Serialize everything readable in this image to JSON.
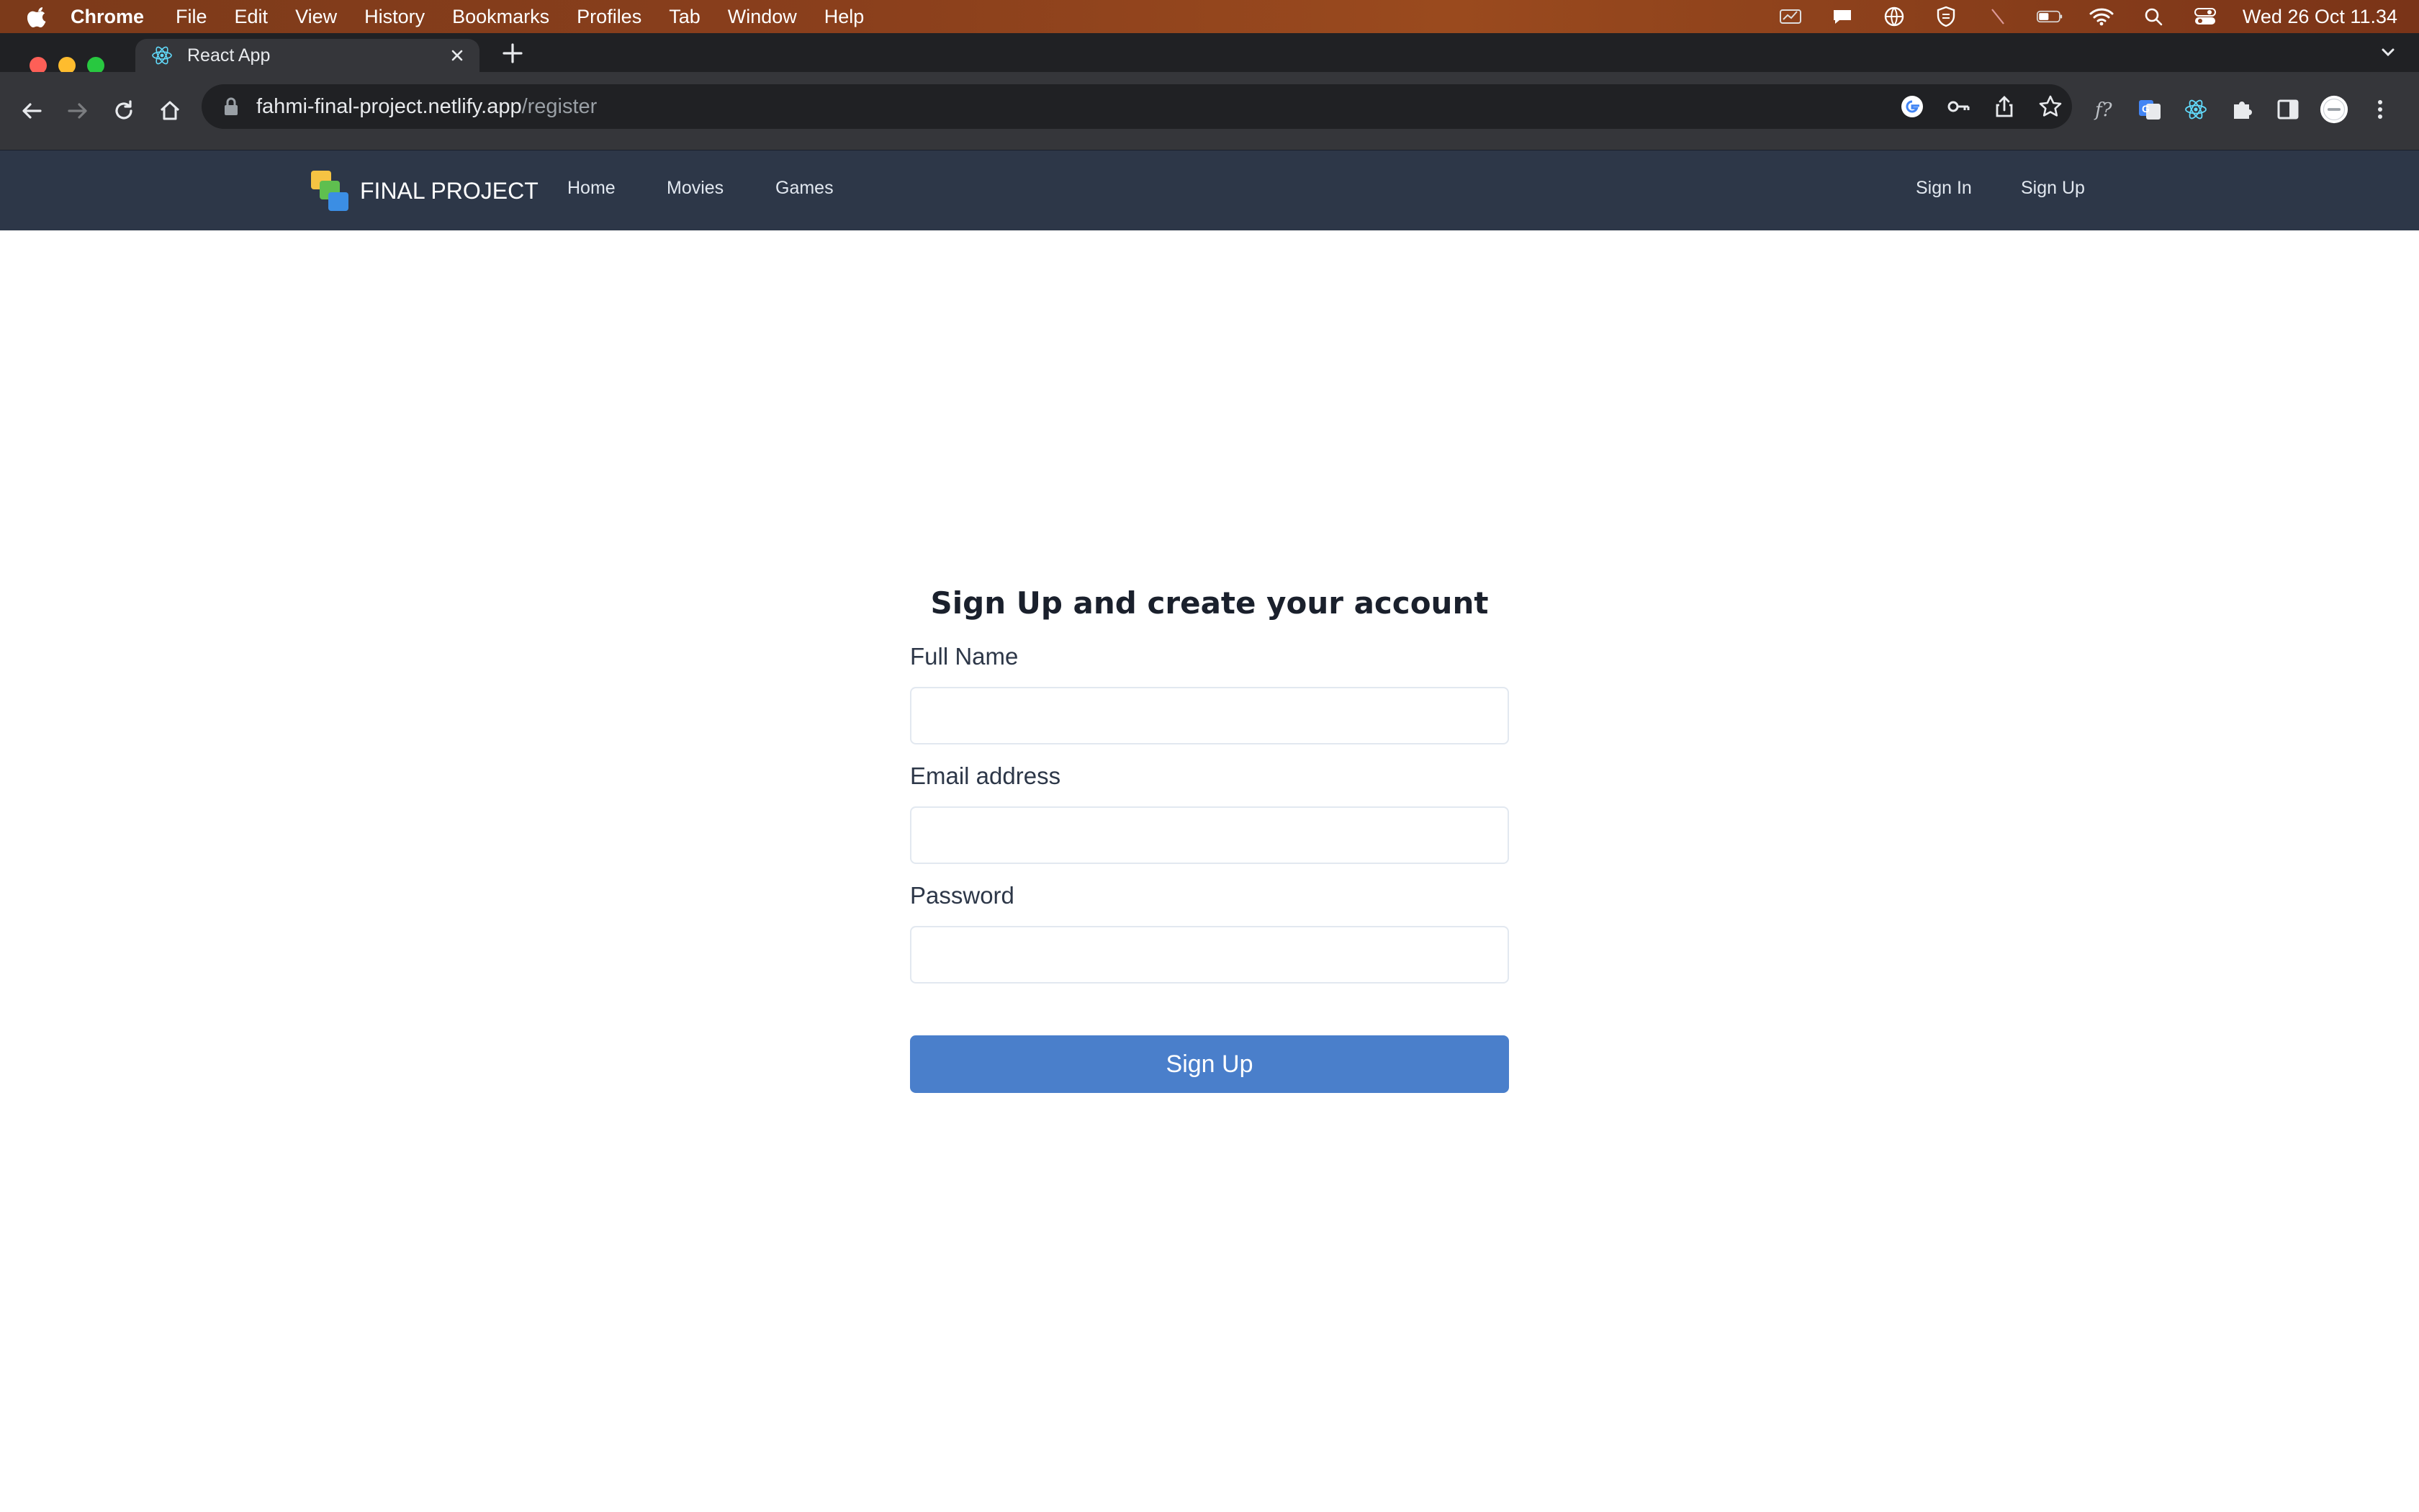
{
  "menubar": {
    "apple_icon": "apple-logo-icon",
    "items": [
      "Chrome",
      "File",
      "Edit",
      "View",
      "History",
      "Bookmarks",
      "Profiles",
      "Tab",
      "Window",
      "Help"
    ],
    "clock": "Wed 26 Oct  11.34"
  },
  "browser": {
    "tab_title": "React App",
    "url_host": "fahmi-final-project.netlify.app",
    "url_path": "/register"
  },
  "site": {
    "brand": "FINAL PROJECT",
    "nav_left": [
      "Home",
      "Movies",
      "Games"
    ],
    "nav_right": [
      "Sign In",
      "Sign Up"
    ]
  },
  "form": {
    "title": "Sign Up and create your account",
    "full_name_label": "Full Name",
    "full_name_value": "",
    "email_label": "Email address",
    "email_value": "",
    "password_label": "Password",
    "password_value": "",
    "submit_label": "Sign Up"
  },
  "colors": {
    "nav_bg": "#2d3748",
    "button_bg": "#4a7fcb",
    "chrome_dark": "#202124",
    "chrome_toolbar": "#35363a"
  }
}
